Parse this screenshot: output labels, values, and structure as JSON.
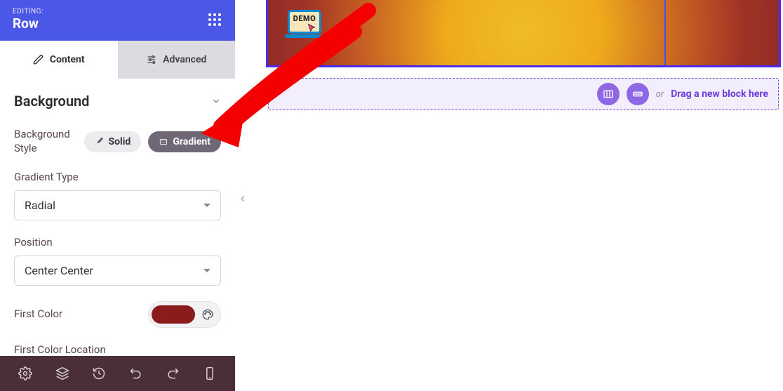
{
  "panel": {
    "editing_label": "EDITING:",
    "row_title": "Row"
  },
  "tabs": {
    "content": "Content",
    "advanced": "Advanced"
  },
  "section": {
    "title": "Background"
  },
  "bg_style": {
    "label": "Background Style",
    "solid": "Solid",
    "gradient": "Gradient"
  },
  "gradient_type": {
    "label": "Gradient Type",
    "value": "Radial"
  },
  "position": {
    "label": "Position",
    "value": "Center Center"
  },
  "first_color": {
    "label": "First Color",
    "value": "#8c1c1c"
  },
  "first_color_location": {
    "label": "First Color Location"
  },
  "demo": {
    "text": "DEMO"
  },
  "dropbar": {
    "or": "or",
    "drag": "Drag a new block here"
  }
}
